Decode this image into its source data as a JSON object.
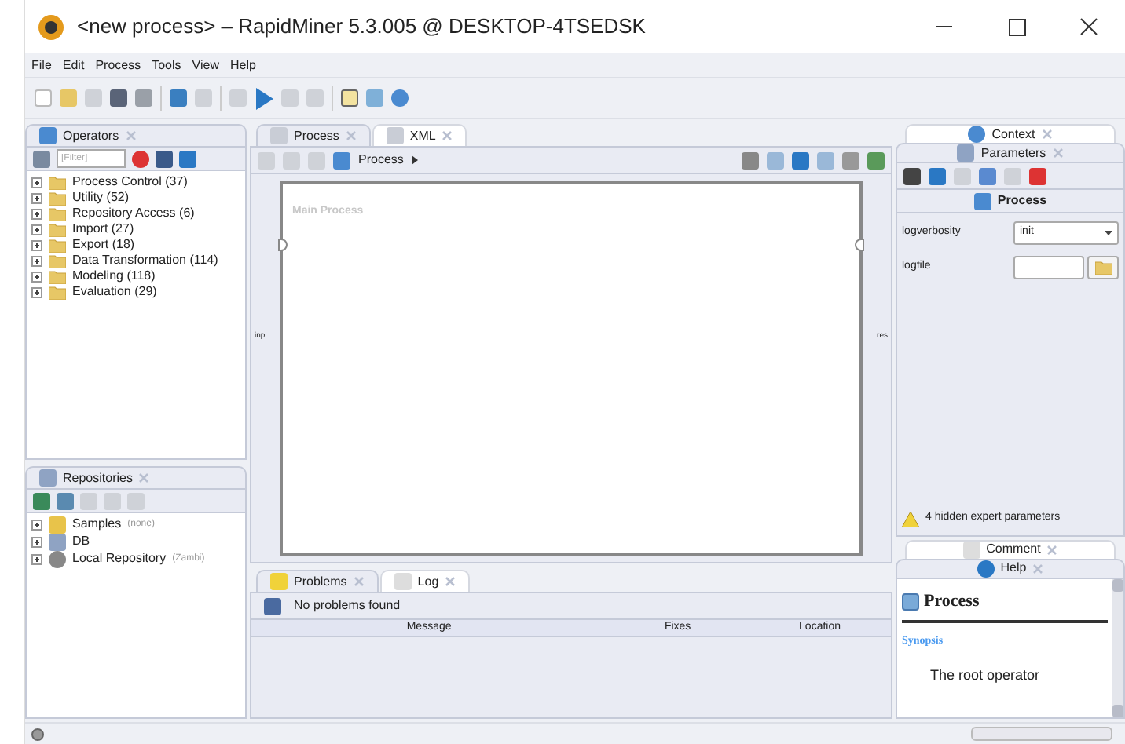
{
  "window": {
    "title": "<new process> – RapidMiner 5.3.005 @ DESKTOP-4TSEDSK"
  },
  "menu": [
    "File",
    "Edit",
    "Process",
    "Tools",
    "View",
    "Help"
  ],
  "operators": {
    "tab": "Operators",
    "filter": {
      "placeholder": "[Filter]"
    },
    "tree": [
      {
        "label": "Process Control (37)",
        "expanded": false
      },
      {
        "label": "Utility (52)",
        "expanded": false
      },
      {
        "label": "Repository Access (6)",
        "expanded": false
      },
      {
        "label": "Import (27)",
        "expanded": false
      },
      {
        "label": "Export (18)",
        "expanded": false
      },
      {
        "label": "Data Transformation (114)",
        "expanded": false
      },
      {
        "label": "Modeling (118)",
        "expanded": false
      },
      {
        "label": "Evaluation (29)",
        "expanded": false
      }
    ]
  },
  "repositories": {
    "tab": "Repositories",
    "tree": [
      {
        "label": "Samples",
        "note": "(none)",
        "kind": "samples",
        "expanded": false
      },
      {
        "label": "DB",
        "kind": "db",
        "expanded": false
      },
      {
        "label": "Local Repository",
        "note": "(Zambi)",
        "kind": "local",
        "expanded": false
      }
    ]
  },
  "process_tabs": [
    {
      "label": "Process",
      "selected": true
    },
    {
      "label": "XML",
      "selected": false
    }
  ],
  "breadcrumb": "Process",
  "canvas": {
    "title": "Main Process",
    "input_port": "inp",
    "output_port": "res"
  },
  "bottom_tabs": [
    {
      "label": "Problems",
      "selected": true
    },
    {
      "label": "Log",
      "selected": false
    }
  ],
  "problems": {
    "status": "No problems found",
    "columns": [
      "Message",
      "Fixes",
      "Location"
    ]
  },
  "right_top_tabs": [
    {
      "label": "Context",
      "selected": false
    },
    {
      "label": "Parameters",
      "selected": true
    }
  ],
  "parameters": {
    "heading": "Process",
    "items": [
      {
        "label": "logverbosity",
        "kind": "select",
        "value": "init"
      },
      {
        "label": "logfile",
        "kind": "file"
      }
    ],
    "hidden_note": "4 hidden expert parameters"
  },
  "right_bottom_tabs": [
    {
      "label": "Comment",
      "selected": false
    },
    {
      "label": "Help",
      "selected": true
    }
  ],
  "help": {
    "heading": "Process",
    "section": "Synopsis",
    "text": "The root operator"
  }
}
